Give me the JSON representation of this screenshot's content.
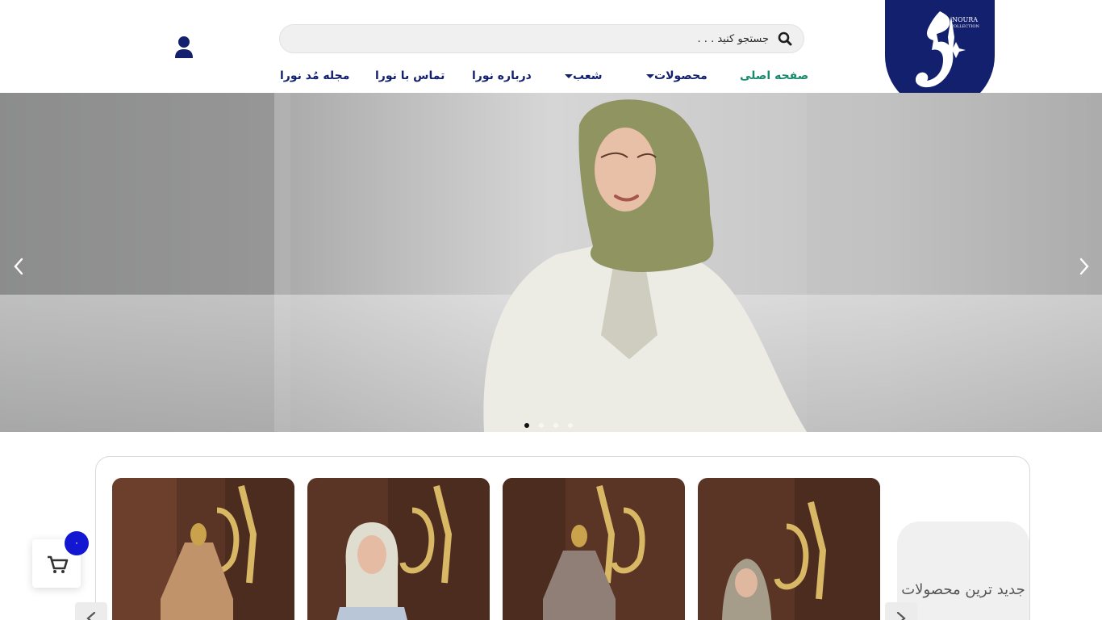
{
  "header": {
    "logo_text_ar": "نورا",
    "logo_text_en": "NOURA",
    "logo_subtext_en": "COLLECTION",
    "search_placeholder": "جستجو کنید . . .",
    "nav": [
      {
        "label": "صفحه اصلی",
        "active": true
      },
      {
        "label": "محصولات",
        "has_dropdown": true
      },
      {
        "label": "شعب",
        "has_dropdown": true
      },
      {
        "label": "درباره نورا"
      },
      {
        "label": "تماس با نورا"
      },
      {
        "label": "مجله مُد نورا"
      }
    ],
    "colors": {
      "brand": "#13206d",
      "active_nav": "#1a8a6e"
    }
  },
  "hero": {
    "slide_count": 4,
    "active_slide": 1
  },
  "products": {
    "section_title": "جدید ترین محصولات",
    "cards": [
      {
        "icon": "product-image-beige-dress"
      },
      {
        "icon": "product-image-floral-hijab"
      },
      {
        "icon": "product-image-grey-dress"
      },
      {
        "icon": "product-image-model-hijab"
      }
    ]
  },
  "cart": {
    "count": "۰"
  }
}
